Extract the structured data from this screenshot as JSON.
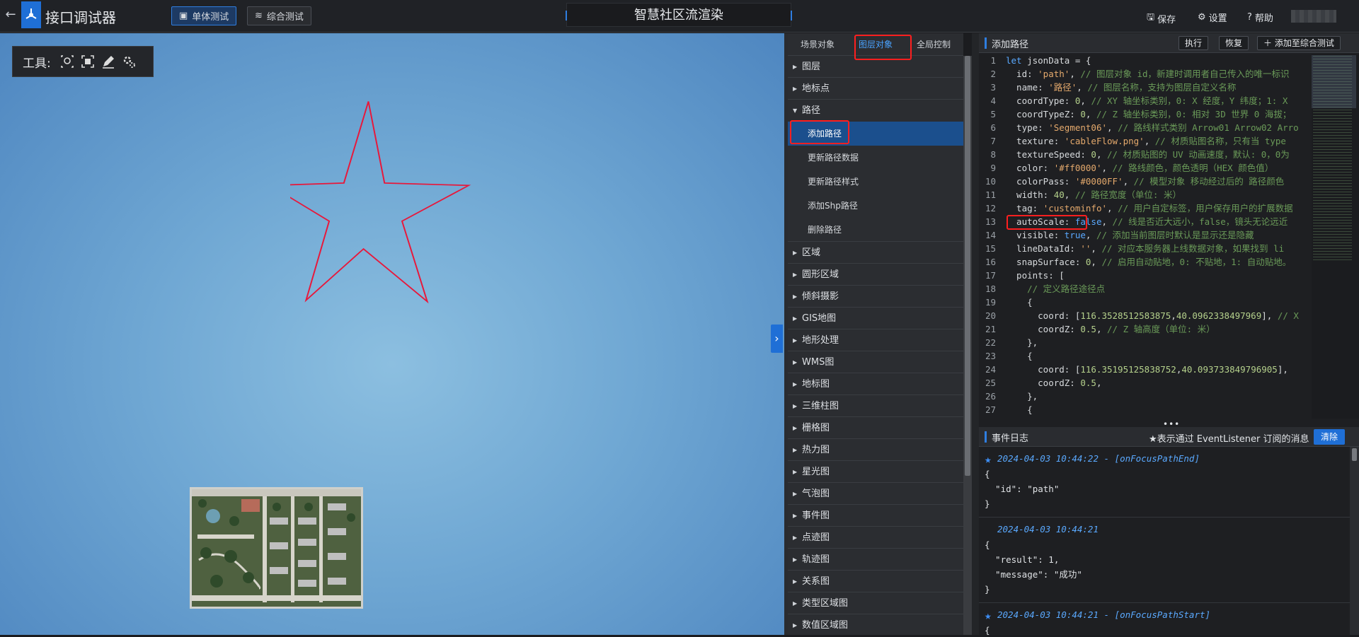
{
  "header": {
    "back_icon": "arrow-left-icon",
    "app_title": "接口调试器",
    "tabs": [
      {
        "label": "单体测试",
        "active": true,
        "icon": "cube-icon"
      },
      {
        "label": "综合测试",
        "active": false,
        "icon": "layers-icon"
      }
    ],
    "center_title": "智慧社区流渲染",
    "actions": [
      {
        "label": "保存",
        "icon": "save-icon"
      },
      {
        "label": "设置",
        "icon": "gear-icon"
      },
      {
        "label": "帮助",
        "icon": "help-icon"
      }
    ]
  },
  "toolbar": {
    "label": "工具:",
    "tools": [
      "locate-icon",
      "focus-icon",
      "pen-icon",
      "settings-icon"
    ]
  },
  "scene": {
    "star_color": "#e8173a",
    "map_label": ""
  },
  "panel_tabs": [
    {
      "label": "场景对象",
      "active": false
    },
    {
      "label": "图层对象",
      "active": true
    },
    {
      "label": "全局控制",
      "active": false
    }
  ],
  "tree": {
    "before": [
      "图层",
      "地标点"
    ],
    "expanded": "路径",
    "children": [
      {
        "label": "添加路径",
        "selected": true
      },
      {
        "label": "更新路径数据",
        "selected": false
      },
      {
        "label": "更新路径样式",
        "selected": false
      },
      {
        "label": "添加Shp路径",
        "selected": false
      },
      {
        "label": "删除路径",
        "selected": false
      }
    ],
    "after": [
      "区域",
      "圆形区域",
      "倾斜摄影",
      "GIS地图",
      "地形处理",
      "WMS图",
      "地标图",
      "三维柱图",
      "栅格图",
      "热力图",
      "星光图",
      "气泡图",
      "事件图",
      "点迹图",
      "轨迹图",
      "关系图",
      "类型区域图",
      "数值区域图"
    ]
  },
  "code_panel": {
    "title": "添加路径",
    "buttons": {
      "run": "执行",
      "restore": "恢复",
      "add": "添加至综合测试"
    },
    "lines": [
      "let jsonData = {",
      "  id: 'path', // 图层对象 id，新建时调用者自己传入的唯一标识",
      "  name: '路径', // 图层名称，支持为图层自定义名称",
      "  coordType: 0, // XY 轴坐标类别，0: X 经度，Y 纬度；1: X",
      "  coordTypeZ: 0, // Z 轴坐标类别，0: 相对 3D 世界 0 海拔；",
      "  type: 'Segment06', // 路线样式类别 Arrow01 Arrow02 Arro",
      "  texture: 'cableFlow.png', // 材质贴图名称，只有当 type",
      "  textureSpeed: 0, // 材质贴图的 UV 动画速度，默认: 0，0为",
      "  color: '#ff0000', // 路线颜色，颜色透明（HEX 颜色值）",
      "  colorPass: '#0000FF', // 模型对象 移动经过后的 路径颜色",
      "  width: 40, // 路径宽度（单位: 米）",
      "  tag: 'custominfo', // 用户自定标签，用户保存用户的扩展数据",
      "  autoScale: false, // 线是否近大远小，false，镜头无论远近",
      "  visible: true, // 添加当前图层时默认是显示还是隐藏",
      "  lineDataId: '', // 对应本服务器上线数据对象，如果找到 li",
      "  snapSurface: 0, // 启用自动贴地，0: 不贴地，1: 自动贴地。",
      "  points: [",
      "    // 定义路径途径点",
      "    {",
      "      coord: [116.3528512583875,40.0962338497969], // X",
      "      coordZ: 0.5, // Z 轴高度（单位: 米）",
      "    },",
      "    {",
      "      coord: [116.35195125838752,40.093733849796905],",
      "      coordZ: 0.5,",
      "    },",
      "    {"
    ],
    "line_numbers": [
      "1",
      "2",
      "3",
      "4",
      "5",
      "6",
      "7",
      "8",
      "9",
      "10",
      "11",
      "12",
      "13",
      "14",
      "15",
      "16",
      "17",
      "18",
      "19",
      "20",
      "21",
      "22",
      "23",
      "24",
      "25",
      "26",
      "27"
    ]
  },
  "log_panel": {
    "title": "事件日志",
    "note": "★表示通过 EventListener 订阅的消息",
    "clear": "清除",
    "entries": [
      {
        "starred": true,
        "time": "2024-04-03 10:44:22 - [onFocusPathEnd]",
        "body": "{\n  \"id\": \"path\"\n}"
      },
      {
        "starred": false,
        "time": "2024-04-03 10:44:21",
        "body": "{\n  \"result\": 1,\n  \"message\": \"成功\"\n}"
      },
      {
        "starred": true,
        "time": "2024-04-03 10:44:21 - [onFocusPathStart]",
        "body": "{"
      }
    ]
  }
}
